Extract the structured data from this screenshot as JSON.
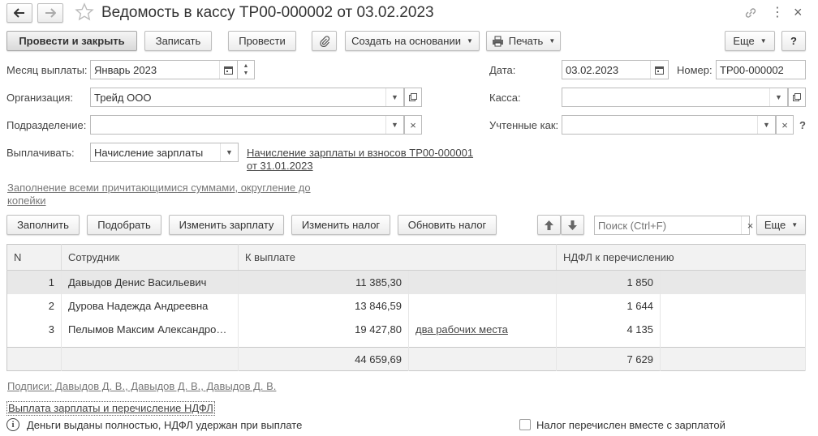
{
  "window": {
    "title": "Ведомость в кассу ТР00-000002 от 03.02.2023"
  },
  "toolbar": {
    "post_and_close": "Провести и закрыть",
    "save": "Записать",
    "post": "Провести",
    "create_based_on": "Создать на основании",
    "print": "Печать",
    "more": "Еще",
    "help": "?"
  },
  "form": {
    "payment_month_label": "Месяц выплаты:",
    "payment_month_value": "Январь 2023",
    "date_label": "Дата:",
    "date_value": "03.02.2023",
    "number_label": "Номер:",
    "number_value": "ТР00-000002",
    "organization_label": "Организация:",
    "organization_value": "Трейд ООО",
    "cashbox_label": "Касса:",
    "cashbox_value": "",
    "department_label": "Подразделение:",
    "department_value": "",
    "accounted_as_label": "Учтенные как:",
    "accounted_as_value": "",
    "accounted_as_help": "?",
    "pay_label": "Выплачивать:",
    "pay_value": "Начисление зарплаты",
    "pay_doc_link_line1": "Начисление зарплаты и взносов ТР00-000001",
    "pay_doc_link_line2": "от 31.01.2023",
    "fill_hint_line1": "Заполнение всеми причитающимися суммами, округление до",
    "fill_hint_line2": "копейки"
  },
  "table_toolbar": {
    "fill": "Заполнить",
    "pick": "Подобрать",
    "change_salary": "Изменить зарплату",
    "change_tax": "Изменить налог",
    "update_tax": "Обновить налог",
    "search_placeholder": "Поиск (Ctrl+F)",
    "more": "Еще"
  },
  "table": {
    "columns": [
      "N",
      "Сотрудник",
      "К выплате",
      "",
      "НДФЛ к перечислению",
      ""
    ],
    "rows": [
      {
        "n": "1",
        "employee": "Давыдов Денис Васильевич",
        "amount": "11 385,30",
        "note": "",
        "ndfl": "1 850"
      },
      {
        "n": "2",
        "employee": "Дурова Надежда Андреевна",
        "amount": "13 846,59",
        "note": "",
        "ndfl": "1 644"
      },
      {
        "n": "3",
        "employee": "Пелымов Максим Александро…",
        "amount": "19 427,80",
        "note": "два рабочих места",
        "ndfl": "4 135"
      }
    ],
    "total_amount": "44 659,69",
    "total_ndfl": "7 629"
  },
  "footer": {
    "signatures_link": "Подписи: Давыдов Д. В., Давыдов Д. В., Давыдов Д. В.",
    "payment_link": "Выплата зарплаты и перечисление НДФЛ",
    "info_text": "Деньги выданы полностью, НДФЛ удержан при выплате",
    "checkbox_label": "Налог перечислен вместе с зарплатой"
  }
}
